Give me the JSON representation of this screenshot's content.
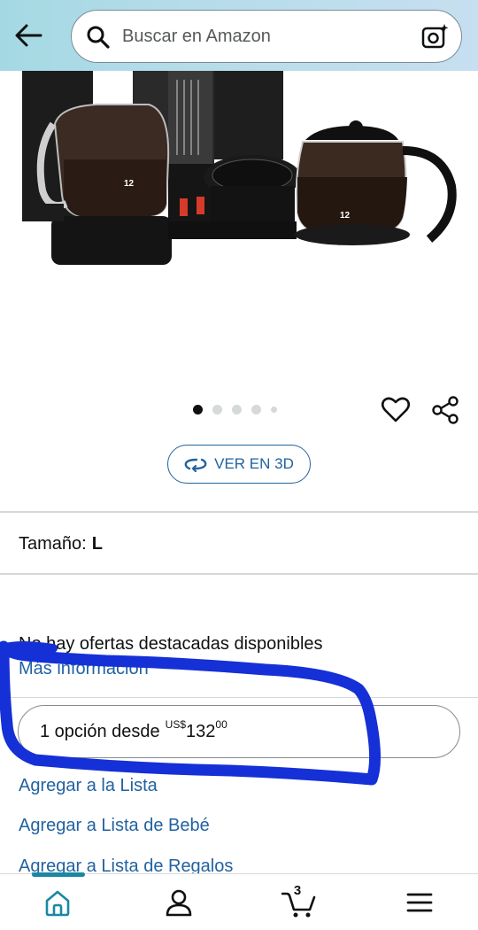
{
  "search": {
    "placeholder": "Buscar en Amazon"
  },
  "product": {
    "image_alt": "Cafetera con dos jarras",
    "carafe_label_left": "12",
    "carafe_label_right": "12",
    "carousel": {
      "total": 5,
      "active_index": 0
    }
  },
  "actions": {
    "ver3d_label": "VER EN 3D"
  },
  "size": {
    "label": "Tamaño:",
    "value": "L"
  },
  "offers": {
    "none_text": "No hay ofertas destacadas disponibles",
    "more_info": "Más información",
    "option_text": "1 opción desde",
    "currency": "US$",
    "price_whole": "132",
    "price_fraction": "00"
  },
  "links": {
    "add_list": "Agregar a la Lista",
    "add_baby_list": "Agregar a Lista de Bebé",
    "add_gift_list": "Agregar a Lista de Regalos"
  },
  "nav": {
    "cart_count": "3",
    "active": "home"
  },
  "colors": {
    "link": "#2162a1",
    "scribble": "#1530d6",
    "nav_active": "#1b87a3"
  },
  "icons": [
    "back-arrow-icon",
    "search-icon",
    "camera-icon",
    "heart-icon",
    "share-icon",
    "rotate-3d-icon",
    "home-icon",
    "account-icon",
    "cart-icon",
    "menu-icon"
  ]
}
